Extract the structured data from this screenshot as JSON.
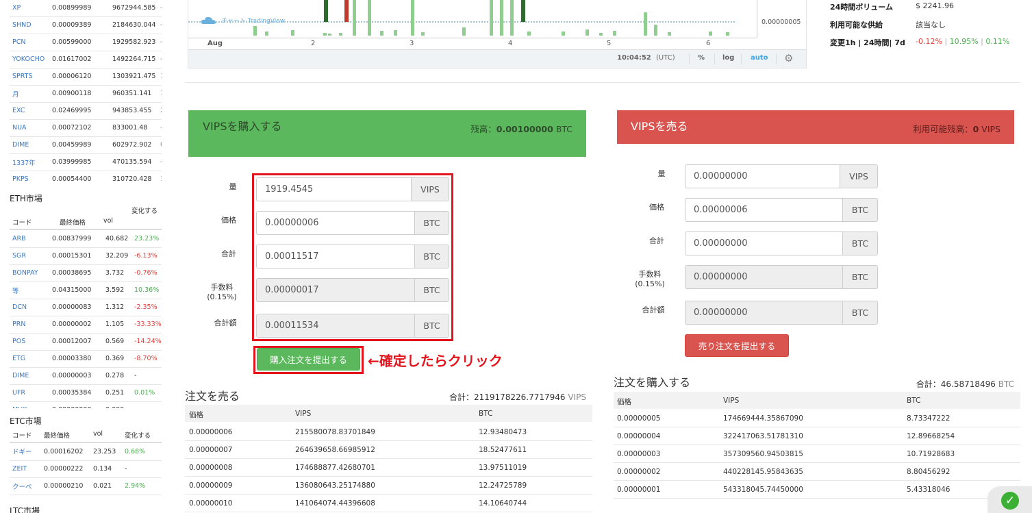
{
  "btc_market": {
    "rows": [
      {
        "code": "XP",
        "price": "0.00899989",
        "vol": "9672944.585",
        "change": "-",
        "dir": "neg"
      },
      {
        "code": "SHND",
        "price": "0.00009389",
        "vol": "2184630.044",
        "change": "-",
        "dir": "neg"
      },
      {
        "code": "PCN",
        "price": "0.00599000",
        "vol": "1929582.923",
        "change": "-",
        "dir": "neg"
      },
      {
        "code": "YOKOCHO",
        "price": "0.01617002",
        "vol": "1492264.715",
        "change": "-",
        "dir": "neg"
      },
      {
        "code": "SPRTS",
        "price": "0.00006120",
        "vol": "1303921.475",
        "change": "1",
        "dir": "pos"
      },
      {
        "code": "月",
        "price": "0.00900118",
        "vol": "960351.141",
        "change": "1",
        "dir": "pos"
      },
      {
        "code": "EXC",
        "price": "0.02469995",
        "vol": "943853.455",
        "change": "2",
        "dir": "pos"
      },
      {
        "code": "NUA",
        "price": "0.00072102",
        "vol": "833001.48",
        "change": "-",
        "dir": "neg"
      },
      {
        "code": "DIME",
        "price": "0.00459989",
        "vol": "602972.902",
        "change": "0",
        "dir": "pos"
      },
      {
        "code": "1337年",
        "price": "0.03999985",
        "vol": "470135.594",
        "change": "-",
        "dir": "neg"
      },
      {
        "code": "PKPS",
        "price": "0.00054400",
        "vol": "310720.428",
        "change": "1",
        "dir": "pos"
      }
    ]
  },
  "eth_market": {
    "title": "ETH市場",
    "headers": {
      "code": "コード",
      "price": "最終価格",
      "vol": "vol",
      "change": "変化する"
    },
    "rows": [
      {
        "code": "ARB",
        "price": "0.00837999",
        "vol": "40.682",
        "change": "23.23%",
        "dir": "pos"
      },
      {
        "code": "SGR",
        "price": "0.00015301",
        "vol": "32.209",
        "change": "-6.13%",
        "dir": "neg"
      },
      {
        "code": "BONPAY",
        "price": "0.00038695",
        "vol": "3.732",
        "change": "-0.76%",
        "dir": "neg"
      },
      {
        "code": "等",
        "price": "0.04315000",
        "vol": "3.592",
        "change": "10.36%",
        "dir": "pos"
      },
      {
        "code": "DCN",
        "price": "0.00000083",
        "vol": "1.312",
        "change": "-2.35%",
        "dir": "neg"
      },
      {
        "code": "PRN",
        "price": "0.00000002",
        "vol": "1.105",
        "change": "-33.33%",
        "dir": "neg"
      },
      {
        "code": "POS",
        "price": "0.00012007",
        "vol": "0.569",
        "change": "-14.24%",
        "dir": "neg"
      },
      {
        "code": "ETG",
        "price": "0.00003380",
        "vol": "0.369",
        "change": "-8.70%",
        "dir": "neg"
      },
      {
        "code": "DIME",
        "price": "0.00000003",
        "vol": "0.278",
        "change": "-",
        "dir": "neutral"
      },
      {
        "code": "UFR",
        "price": "0.00035384",
        "vol": "0.251",
        "change": "0.01%",
        "dir": "pos"
      },
      {
        "code": "MUX",
        "price": "0.00000000",
        "vol": "0.000",
        "change": "",
        "dir": "neutral"
      }
    ]
  },
  "etc_market": {
    "title": "ETC市場",
    "headers": {
      "code": "コード",
      "price": "最終価格",
      "vol": "vol",
      "change": "変化する"
    },
    "rows": [
      {
        "code": "ドギー",
        "price": "0.00016202",
        "vol": "23.253",
        "change": "0.68%",
        "dir": "pos"
      },
      {
        "code": "ZEIT",
        "price": "0.00000222",
        "vol": "0.134",
        "change": "-",
        "dir": "neutral"
      },
      {
        "code": "クーペ",
        "price": "0.00000210",
        "vol": "0.021",
        "change": "2.94%",
        "dir": "pos"
      }
    ]
  },
  "ltc_market": {
    "title": "LTC市場"
  },
  "chart": {
    "watermark": "チャート TradingView",
    "y_label": "0.00000005",
    "x_ticks": [
      "Aug",
      "2",
      "3",
      "4",
      "5",
      "6"
    ],
    "time": "10:04:52",
    "tz": "(UTC)",
    "pct": "%",
    "log": "log",
    "auto": "auto"
  },
  "stats": {
    "volume_label": "24時間ボリューム",
    "volume_value": "$ 2241.96",
    "supply_label": "利用可能な供給",
    "supply_value": "該当なし",
    "change_label": "変更1h | 24時間| 7d",
    "change_1h": "-0.12%",
    "sep": "|",
    "change_24h": "10.95%",
    "change_7d": "0.11%"
  },
  "buy": {
    "title": "VIPSを購入する",
    "balance_label": "残高：",
    "balance_value": "0.00100000",
    "balance_unit": "BTC",
    "amount_label": "量",
    "amount_value": "1919.4545",
    "amount_unit": "VIPS",
    "price_label": "価格",
    "price_value": "0.00000006",
    "price_unit": "BTC",
    "total_label": "合計",
    "total_value": "0.00011517",
    "total_unit": "BTC",
    "fee_label": "手数料",
    "fee_rate": "(0.15%)",
    "fee_value": "0.00000017",
    "fee_unit": "BTC",
    "grand_label": "合計額",
    "grand_value": "0.00011534",
    "grand_unit": "BTC",
    "submit_label": "購入注文を提出する",
    "annotation": "←確定したらクリック"
  },
  "sell": {
    "title": "VIPSを売る",
    "balance_label": "利用可能残高：",
    "balance_value": "0",
    "balance_unit": "VIPS",
    "amount_label": "量",
    "amount_value": "0.00000000",
    "amount_unit": "VIPS",
    "price_label": "価格",
    "price_value": "0.00000006",
    "price_unit": "BTC",
    "total_label": "合計",
    "total_value": "0.00000000",
    "total_unit": "BTC",
    "fee_label": "手数料",
    "fee_rate": "(0.15%)",
    "fee_value": "0.00000000",
    "fee_unit": "BTC",
    "grand_label": "合計額",
    "grand_value": "0.00000000",
    "grand_unit": "BTC",
    "submit_label": "売り注文を提出する"
  },
  "sell_orders": {
    "title": "注文を売る",
    "total_label": "合計：",
    "total_value": "2119178226.7717946",
    "total_unit": "VIPS",
    "headers": {
      "price": "価格",
      "vips": "VIPS",
      "btc": "BTC"
    },
    "rows": [
      {
        "price": "0.00000006",
        "vips": "215580078.83701849",
        "btc": "12.93480473"
      },
      {
        "price": "0.00000007",
        "vips": "264639658.66985912",
        "btc": "18.52477611"
      },
      {
        "price": "0.00000008",
        "vips": "174688877.42680701",
        "btc": "13.97511019"
      },
      {
        "price": "0.00000009",
        "vips": "136080643.25174880",
        "btc": "12.24725789"
      },
      {
        "price": "0.00000010",
        "vips": "141064074.44396608",
        "btc": "14.10640744"
      }
    ]
  },
  "buy_orders": {
    "title": "注文を購入する",
    "total_label": "合計：",
    "total_value": "46.58718496",
    "total_unit": "BTC",
    "headers": {
      "price": "価格",
      "vips": "VIPS",
      "btc": "BTC"
    },
    "rows": [
      {
        "price": "0.00000005",
        "vips": "174669444.35867090",
        "btc": "8.73347222"
      },
      {
        "price": "0.00000004",
        "vips": "322417063.51781310",
        "btc": "12.89668254"
      },
      {
        "price": "0.00000003",
        "vips": "357309560.94503815",
        "btc": "10.71928683"
      },
      {
        "price": "0.00000002",
        "vips": "440228145.95843635",
        "btc": "8.80456292"
      },
      {
        "price": "0.00000001",
        "vips": "543318045.74450000",
        "btc": "5.43318046"
      }
    ]
  },
  "colors": {
    "buy": "#5cb85c",
    "sell": "#d9534f",
    "highlight": "#e3141d",
    "positive": "#4caf50",
    "negative": "#e0413b"
  }
}
